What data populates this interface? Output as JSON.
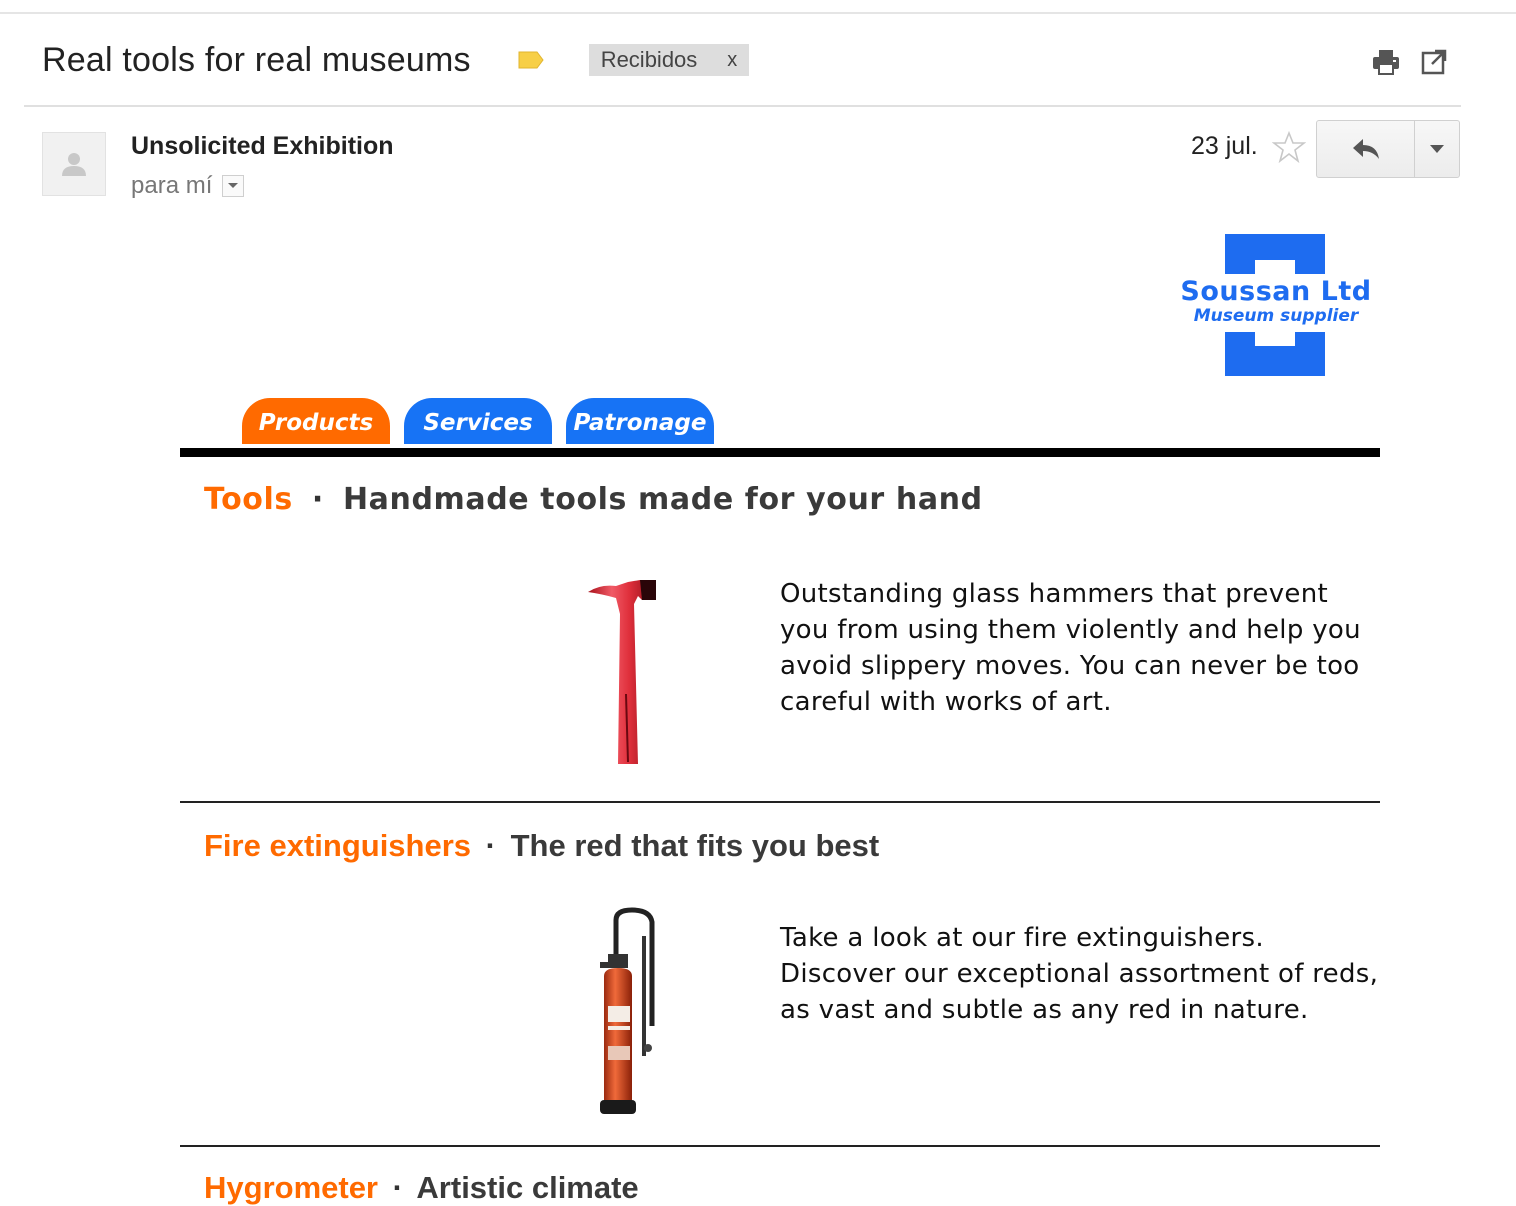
{
  "email": {
    "subject": "Real tools for real museums",
    "label_chip": "Recibidos",
    "label_chip_remove": "x",
    "sender": "Unsolicited Exhibition",
    "recipient": "para mí",
    "date": "23 jul."
  },
  "newsletter": {
    "brand": "Soussan Ltd",
    "tagline": "Museum supplier",
    "tabs": [
      "Products",
      "Services",
      "Patronage"
    ],
    "sections": [
      {
        "category": "Tools",
        "separator": "·",
        "headline": "Handmade tools made for your hand",
        "copy": "Outstanding glass hammers that prevent you from using them violently and help you avoid slippery moves. You can never be too careful with works of art.",
        "image": "red-hammer"
      },
      {
        "category": "Fire extinguishers",
        "separator": "·",
        "headline": "The red that fits you best",
        "copy": "Take a look at our fire extinguishers. Discover our exceptional assortment of reds, as vast and subtle as any red in nature.",
        "image": "fire-extinguisher"
      },
      {
        "category": "Hygrometer",
        "separator": "·",
        "headline": "Artistic climate"
      }
    ]
  },
  "colors": {
    "accent_orange": "#ff6a00",
    "accent_blue": "#1773f5",
    "label_yellow": "#f7cf46"
  },
  "icons": [
    "label-tag-icon",
    "print-icon",
    "open-in-new-window-icon",
    "avatar-placeholder-icon",
    "dropdown-arrow-icon",
    "star-icon",
    "reply-icon",
    "more-options-arrow-icon"
  ]
}
